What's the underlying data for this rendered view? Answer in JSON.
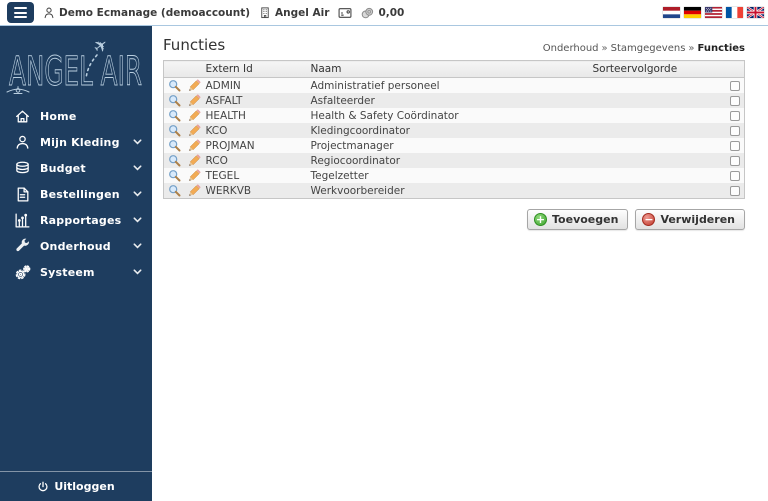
{
  "topbar": {
    "user_label": "Demo Ecmanage (demoaccount)",
    "company_label": "Angel Air",
    "balance": "0,00",
    "icons": [
      "user-icon",
      "building-icon",
      "terminal-icon",
      "coins-icon"
    ],
    "flags": [
      {
        "name": "netherlands"
      },
      {
        "name": "germany"
      },
      {
        "name": "usa"
      },
      {
        "name": "france"
      },
      {
        "name": "united-kingdom"
      }
    ]
  },
  "sidebar": {
    "logo_text": "ANGEL AIR",
    "items": [
      {
        "label": "Home",
        "icon": "home",
        "expandable": false
      },
      {
        "label": "Mijn Kleding",
        "icon": "user",
        "expandable": true
      },
      {
        "label": "Budget",
        "icon": "coins",
        "expandable": true
      },
      {
        "label": "Bestellingen",
        "icon": "document",
        "expandable": true
      },
      {
        "label": "Rapportages",
        "icon": "chart",
        "expandable": true
      },
      {
        "label": "Onderhoud",
        "icon": "wrench",
        "expandable": true
      },
      {
        "label": "Systeem",
        "icon": "gears",
        "expandable": true
      }
    ],
    "logout_label": "Uitloggen"
  },
  "main": {
    "title": "Functies",
    "breadcrumb": [
      "Onderhoud",
      "Stamgegevens",
      "Functies"
    ],
    "breadcrumb_separator": "»",
    "table": {
      "columns": [
        "Extern Id",
        "Naam",
        "Sorteervolgorde"
      ],
      "row_icons": [
        "search-icon",
        "pencil-icon"
      ],
      "rows": [
        {
          "extern_id": "ADMIN",
          "naam": "Administratief personeel",
          "sorteervolgorde": ""
        },
        {
          "extern_id": "ASFALT",
          "naam": "Asfalteerder",
          "sorteervolgorde": ""
        },
        {
          "extern_id": "HEALTH",
          "naam": "Health & Safety Coördinator",
          "sorteervolgorde": ""
        },
        {
          "extern_id": "KCO",
          "naam": "Kledingcoordinator",
          "sorteervolgorde": ""
        },
        {
          "extern_id": "PROJMAN",
          "naam": "Projectmanager",
          "sorteervolgorde": ""
        },
        {
          "extern_id": "RCO",
          "naam": "Regiocoordinator",
          "sorteervolgorde": ""
        },
        {
          "extern_id": "TEGEL",
          "naam": "Tegelzetter",
          "sorteervolgorde": ""
        },
        {
          "extern_id": "WERKVB",
          "naam": "Werkvoorbereider",
          "sorteervolgorde": ""
        }
      ]
    },
    "actions": [
      {
        "label": "Toevoegen",
        "icon": "plus-icon",
        "name": "toevoegen-button"
      },
      {
        "label": "Verwijderen",
        "icon": "minus-icon",
        "name": "verwijderen-button"
      }
    ]
  },
  "colors": {
    "sidebar_bg": "#1e3d5f",
    "topbar_border": "#a9c7e0",
    "row_alt": "#ebebeb",
    "action_green": "#3fa52f",
    "action_red": "#c0392b"
  }
}
